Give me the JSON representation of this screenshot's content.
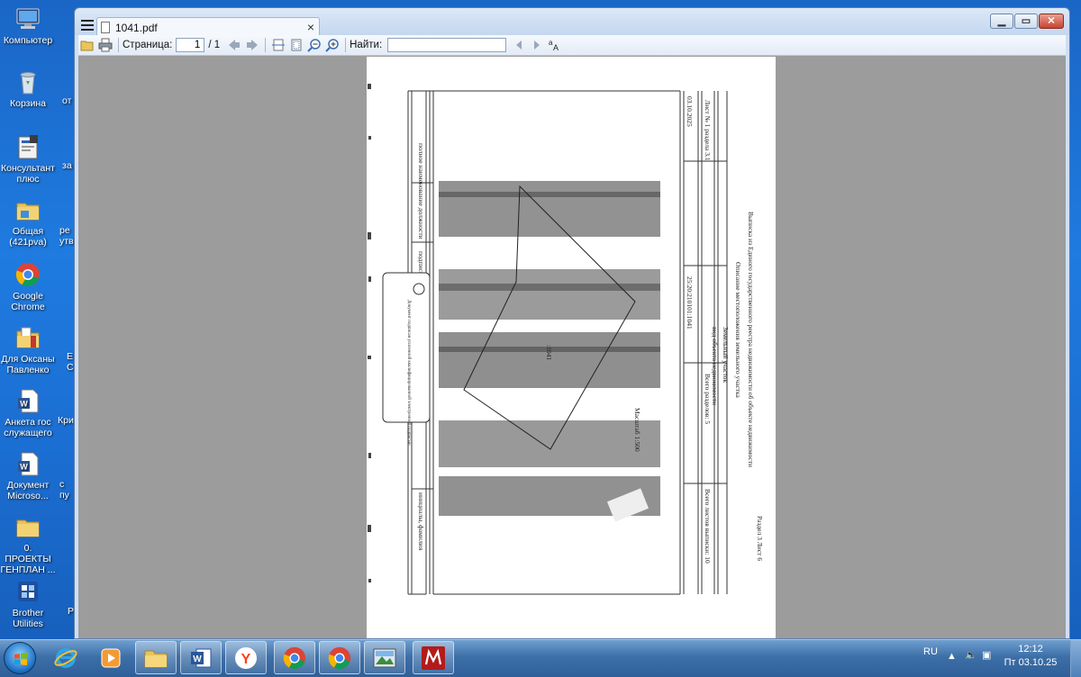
{
  "desktop": {
    "icons": [
      {
        "label": "Компьютер",
        "icon": "computer-icon"
      },
      {
        "label": "Корзина",
        "icon": "recycle-bin-icon"
      },
      {
        "label": "Консультант плюс",
        "icon": "consultant-plus-icon"
      },
      {
        "label": "Общая (421pva)",
        "icon": "shared-folder-icon"
      },
      {
        "label": "Google Chrome",
        "icon": "chrome-icon"
      },
      {
        "label": "Для Оксаны Павленко",
        "icon": "folder-icon"
      },
      {
        "label": "Анкета гос служащего",
        "icon": "word-doc-icon"
      },
      {
        "label": "Документ Microsо...",
        "icon": "word-doc-icon"
      },
      {
        "label": "0. ПРОЕКТЫ ГЕНПЛАН ...",
        "icon": "folder-icon"
      },
      {
        "label": "Brother Utilities",
        "icon": "brother-utilities-icon"
      }
    ],
    "cut_labels": [
      "от",
      "за",
      "ре утв",
      "Е С",
      "Кри",
      "с пу",
      "Р"
    ]
  },
  "window": {
    "tab_title": "1041.pdf",
    "toolbar": {
      "page_label": "Страница:",
      "page_value": "1",
      "page_total": "/ 1",
      "find_label": "Найти:",
      "find_value": ""
    }
  },
  "document": {
    "page_number": "1",
    "rotated_text": {
      "header": "Выписка из Единого государственного реестра недвижимости об объекте недвижимости",
      "subheader": "Описание местоположения земельного участка",
      "object": "Земельный участок",
      "kind": "вид объекта недвижимости",
      "sheet": "Лист № 1 раздела 3.1",
      "sheets_in_section": "Всего листов раздела 3.1: 1",
      "sections": "Всего разделов: 5",
      "total_sheets": "Всего листов выписки: 10",
      "date": "03.10.2025",
      "cadastral": "25:20:210101:1041",
      "section_footer": "Раздел 3 Лист 6",
      "plan_label": "Схема расположения земельного участка",
      "scale": "Масштаб 1:500",
      "parcel_id": ":1041",
      "stamp": "Документ подписан усиленной квалифицированной электронной подписью",
      "position_left": "полное наименование должности",
      "signature": "подпись",
      "initials": "инициалы, фамилия"
    }
  },
  "taskbar": {
    "apps": [
      {
        "name": "internet-explorer",
        "icon": "ie-icon"
      },
      {
        "name": "media-player",
        "icon": "media-player-icon"
      },
      {
        "name": "explorer",
        "icon": "folder-icon"
      },
      {
        "name": "word",
        "icon": "word-icon"
      },
      {
        "name": "yandex",
        "icon": "yandex-icon"
      },
      {
        "name": "chrome-1",
        "icon": "chrome-icon"
      },
      {
        "name": "chrome-2",
        "icon": "chrome-icon"
      },
      {
        "name": "image-viewer",
        "icon": "picture-icon"
      },
      {
        "name": "pdf-reader",
        "icon": "pdf-reader-icon"
      }
    ],
    "tray": {
      "language": "RU",
      "time": "12:12",
      "date": "Пт 03.10.25"
    }
  }
}
